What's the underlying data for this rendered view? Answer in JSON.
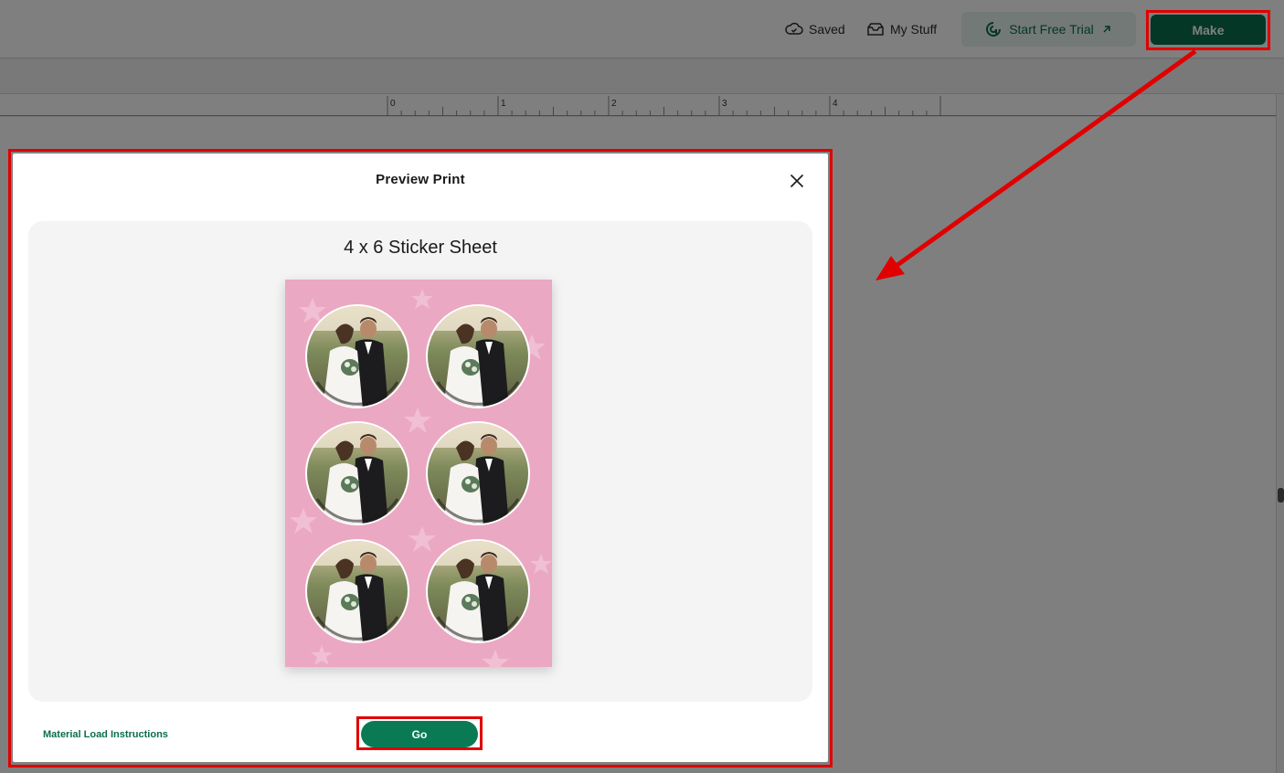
{
  "topbar": {
    "saved_label": "Saved",
    "my_stuff_label": "My Stuff",
    "trial_label": "Start Free Trial",
    "make_label": "Make"
  },
  "ruler": {
    "ticks": [
      "0",
      "1",
      "2",
      "3",
      "4"
    ]
  },
  "modal": {
    "title": "Preview Print",
    "sheet_title": "4 x 6 Sticker Sheet",
    "material_link": "Material Load Instructions",
    "go_label": "Go"
  },
  "colors": {
    "brand_green": "#0a6e4f",
    "sheet_pink": "#eba8c3",
    "annotation_red": "#e00000"
  },
  "icons": [
    "cloud-check-icon",
    "inbox-icon",
    "trial-logo-icon",
    "external-arrow-icon",
    "close-icon"
  ]
}
